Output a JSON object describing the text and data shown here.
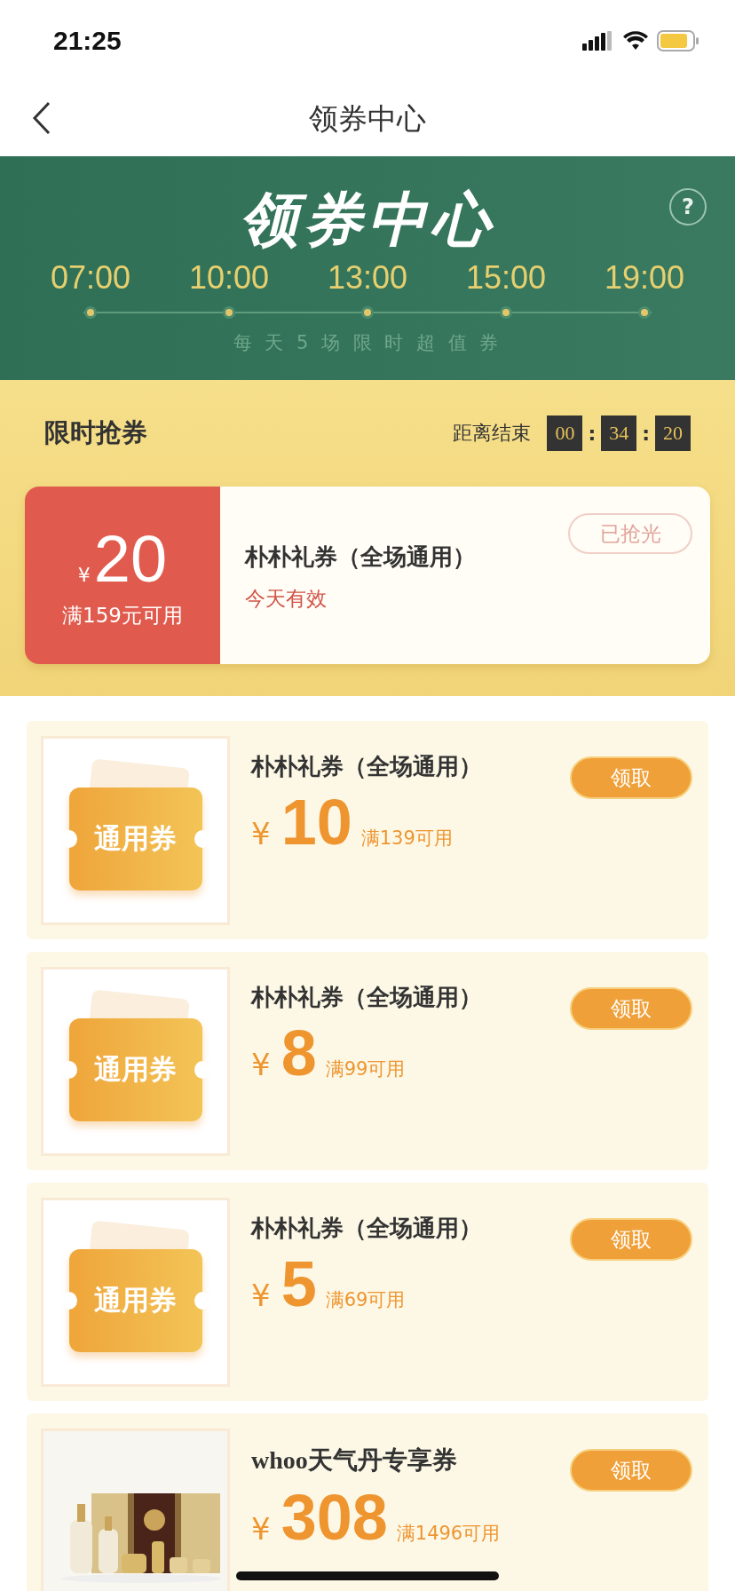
{
  "status_bar": {
    "time": "21:25"
  },
  "nav": {
    "title": "领券中心"
  },
  "banner": {
    "title": "领券中心",
    "help": "?",
    "times": [
      "07:00",
      "10:00",
      "13:00",
      "15:00",
      "19:00"
    ],
    "subtitle": "每 天 5 场 限 时 超 值 券"
  },
  "flash_sale": {
    "title": "限时抢券",
    "countdown_label": "距离结束",
    "countdown": [
      {
        "kind": "digit",
        "text": "00"
      },
      {
        "kind": "sep",
        "text": ":"
      },
      {
        "kind": "digit",
        "text": "34"
      },
      {
        "kind": "sep",
        "text": ":"
      },
      {
        "kind": "digit",
        "text": "20"
      }
    ],
    "coupon": {
      "currency": "¥",
      "amount": "20",
      "condition": "满159元可用",
      "title": "朴朴礼券（全场通用）",
      "validity": "今天有效",
      "button": "已抢光",
      "disabled": true
    }
  },
  "coupons": [
    {
      "kind": "generic",
      "badge_text": "通用券",
      "title": "朴朴礼券（全场通用）",
      "currency": "¥",
      "amount": "10",
      "condition": "满139可用",
      "button": "领取"
    },
    {
      "kind": "generic",
      "badge_text": "通用券",
      "title": "朴朴礼券（全场通用）",
      "currency": "¥",
      "amount": "8",
      "condition": "满99可用",
      "button": "领取"
    },
    {
      "kind": "generic",
      "badge_text": "通用券",
      "title": "朴朴礼券（全场通用）",
      "currency": "¥",
      "amount": "5",
      "condition": "满69可用",
      "button": "领取"
    },
    {
      "kind": "picture",
      "title": "whoo天气丹专享券",
      "currency": "¥",
      "amount": "308",
      "condition": "满1496可用",
      "button": "领取"
    }
  ]
}
